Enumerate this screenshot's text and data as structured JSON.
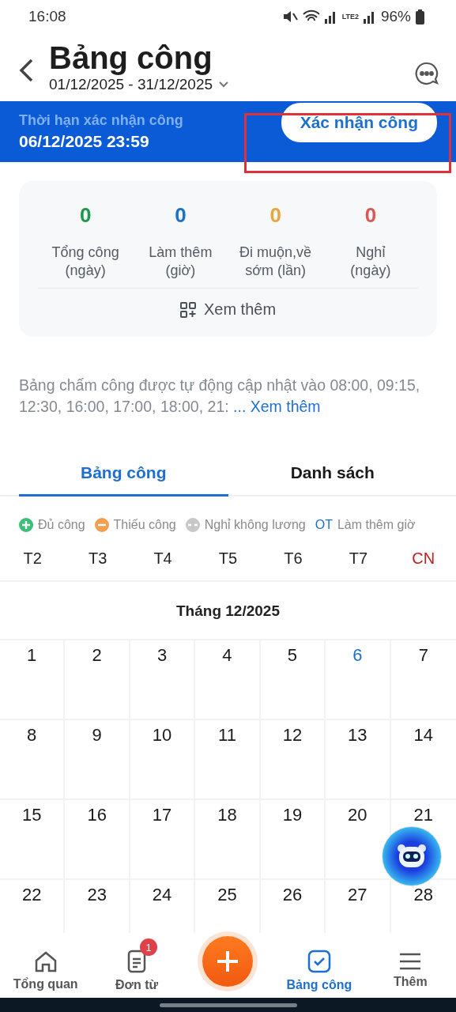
{
  "status_bar": {
    "time": "16:08",
    "network": "LTE2",
    "battery": "96%"
  },
  "header": {
    "title": "Bảng công",
    "date_range": "01/12/2025 - 31/12/2025"
  },
  "deadline_banner": {
    "label": "Thời hạn xác nhận công",
    "deadline": "06/12/2025 23:59",
    "button": {
      "label": "Xác nhận công",
      "highlighted": true
    }
  },
  "summary": {
    "stats": [
      {
        "value": "0",
        "label": "Tổng công (ngày)",
        "color": "#1a9a4a"
      },
      {
        "value": "0",
        "label": "Làm thêm (giờ)",
        "color": "#1b6fd0"
      },
      {
        "value": "0",
        "label": "Đi muộn,về sớm (lần)",
        "color": "#eba43a"
      },
      {
        "value": "0",
        "label": "Nghỉ (ngày)",
        "color": "#e05555"
      }
    ],
    "more": "Xem thêm"
  },
  "notice": {
    "text": "Bảng chấm công được tự động cập nhật vào 08:00, 09:15, 12:30, 16:00, 17:00, 18:00, 21:",
    "link": "... Xem thêm"
  },
  "tabs": [
    {
      "label": "Bảng công",
      "selected": true
    },
    {
      "label": "Danh sách",
      "selected": false
    }
  ],
  "legend": [
    {
      "kind": "plus",
      "label": "Đủ công",
      "color": "#3cbf78"
    },
    {
      "kind": "minus",
      "label": "Thiếu công",
      "color": "#f0a050"
    },
    {
      "kind": "dash",
      "label": "Nghỉ không lương",
      "color": "#c8c8c8"
    },
    {
      "kind": "text",
      "mark": "OT",
      "label": "Làm thêm giờ",
      "color": "#1b6fd0"
    }
  ],
  "weekdays": [
    {
      "label": "T2",
      "weekend": false
    },
    {
      "label": "T3",
      "weekend": false
    },
    {
      "label": "T4",
      "weekend": false
    },
    {
      "label": "T5",
      "weekend": false
    },
    {
      "label": "T6",
      "weekend": false
    },
    {
      "label": "T7",
      "weekend": false
    },
    {
      "label": "CN",
      "weekend": true
    }
  ],
  "calendar": {
    "month": "Tháng 12/2025",
    "days": [
      {
        "day": "1",
        "today": false
      },
      {
        "day": "2",
        "today": false
      },
      {
        "day": "3",
        "today": false
      },
      {
        "day": "4",
        "today": false
      },
      {
        "day": "5",
        "today": false
      },
      {
        "day": "6",
        "today": true
      },
      {
        "day": "7",
        "today": false
      },
      {
        "day": "8",
        "today": false
      },
      {
        "day": "9",
        "today": false
      },
      {
        "day": "10",
        "today": false
      },
      {
        "day": "11",
        "today": false
      },
      {
        "day": "12",
        "today": false
      },
      {
        "day": "13",
        "today": false
      },
      {
        "day": "14",
        "today": false
      },
      {
        "day": "15",
        "today": false
      },
      {
        "day": "16",
        "today": false
      },
      {
        "day": "17",
        "today": false
      },
      {
        "day": "18",
        "today": false
      },
      {
        "day": "19",
        "today": false
      },
      {
        "day": "20",
        "today": false
      },
      {
        "day": "21",
        "today": false
      },
      {
        "day": "22",
        "today": false
      },
      {
        "day": "23",
        "today": false
      },
      {
        "day": "24",
        "today": false
      },
      {
        "day": "25",
        "today": false
      },
      {
        "day": "26",
        "today": false
      },
      {
        "day": "27",
        "today": false
      },
      {
        "day": "28",
        "today": false
      }
    ]
  },
  "bottom_nav": [
    {
      "kind": "home",
      "label": "Tổng quan",
      "selected": false
    },
    {
      "kind": "forms",
      "label": "Đơn từ",
      "selected": false,
      "badge": "1"
    },
    {
      "kind": "add"
    },
    {
      "kind": "timesheet",
      "label": "Bảng công",
      "selected": true
    },
    {
      "kind": "menu",
      "label": "Thêm",
      "selected": false
    }
  ]
}
